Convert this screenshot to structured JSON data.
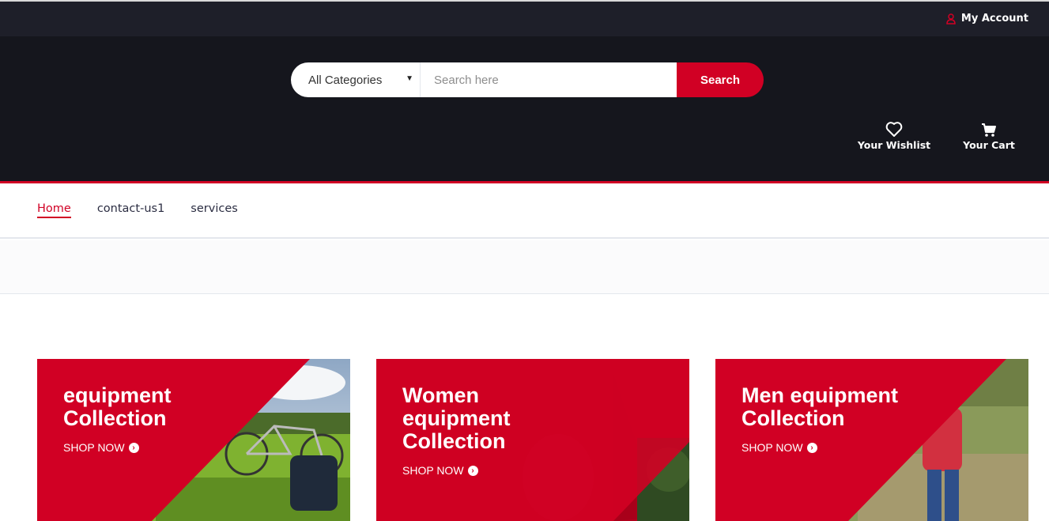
{
  "topbar": {
    "account_label": "My Account"
  },
  "search": {
    "category_selected": "All Categories",
    "placeholder": "Search here",
    "button_label": "Search"
  },
  "header_links": {
    "wishlist": "Your Wishlist",
    "cart": "Your Cart"
  },
  "nav": {
    "items": [
      "Home",
      "contact-us1",
      "services"
    ],
    "active": "Home"
  },
  "collections": [
    {
      "title": "equipment Collection",
      "cta": "SHOP NOW"
    },
    {
      "title": "Women equipment Collection",
      "cta": "SHOP NOW"
    },
    {
      "title": "Men equipment Collection",
      "cta": "SHOP NOW"
    }
  ],
  "colors": {
    "accent": "#d10024",
    "topbar": "#1e1f29",
    "header": "#15161d"
  },
  "icons": [
    "user-icon",
    "heart-icon",
    "cart-icon",
    "arrow-circle-right-icon"
  ]
}
